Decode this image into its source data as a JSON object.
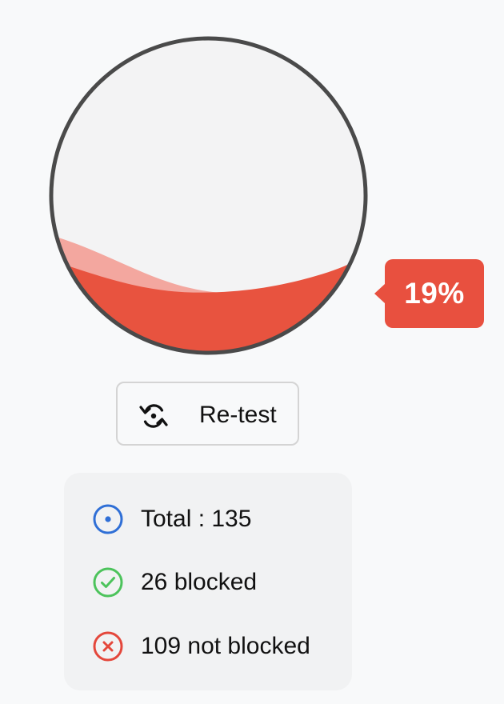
{
  "gauge": {
    "percent": 19,
    "percent_label": "19%",
    "fill_color": "#e8533f",
    "wave_color": "#f3a79f",
    "empty_color": "#f3f3f4",
    "border_color": "#4a4a4a"
  },
  "retest": {
    "label": "Re-test",
    "icon": "refresh-icon"
  },
  "stats": {
    "total_label": "Total : 135",
    "blocked_label": "26 blocked",
    "not_blocked_label": "109 not blocked",
    "total_icon": "radio-dot-icon",
    "blocked_icon": "check-circle-icon",
    "not_blocked_icon": "x-circle-icon",
    "colors": {
      "total": "#2f6fd6",
      "blocked": "#4cc35b",
      "not_blocked": "#e4473b"
    }
  }
}
